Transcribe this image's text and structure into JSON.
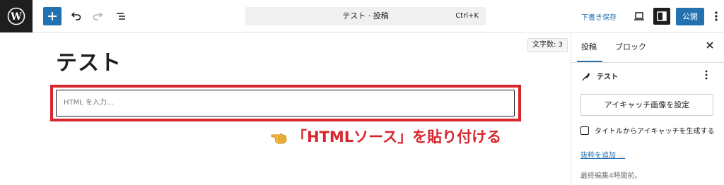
{
  "toolbar": {
    "command_title": "テスト · 投稿",
    "command_shortcut": "Ctrl+K",
    "save_draft": "下書き保存",
    "publish": "公開"
  },
  "editor": {
    "word_count": "文字数: 3",
    "post_title": "テスト",
    "html_placeholder": "HTML を入力…"
  },
  "annotation": {
    "text": "「HTMLソース」を貼り付ける",
    "color": "#d7262d"
  },
  "sidebar": {
    "tab_post": "投稿",
    "tab_block": "ブロック",
    "doc_title": "テスト",
    "featured_image_button": "アイキャッチ画像を設定",
    "generate_checkbox_label": "タイトルからアイキャッチを生成する",
    "add_excerpt": "抜粋を追加 …",
    "last_edited": "最終編集4時間前。"
  },
  "colors": {
    "accent": "#2271b1",
    "dark": "#1e1e1e"
  }
}
